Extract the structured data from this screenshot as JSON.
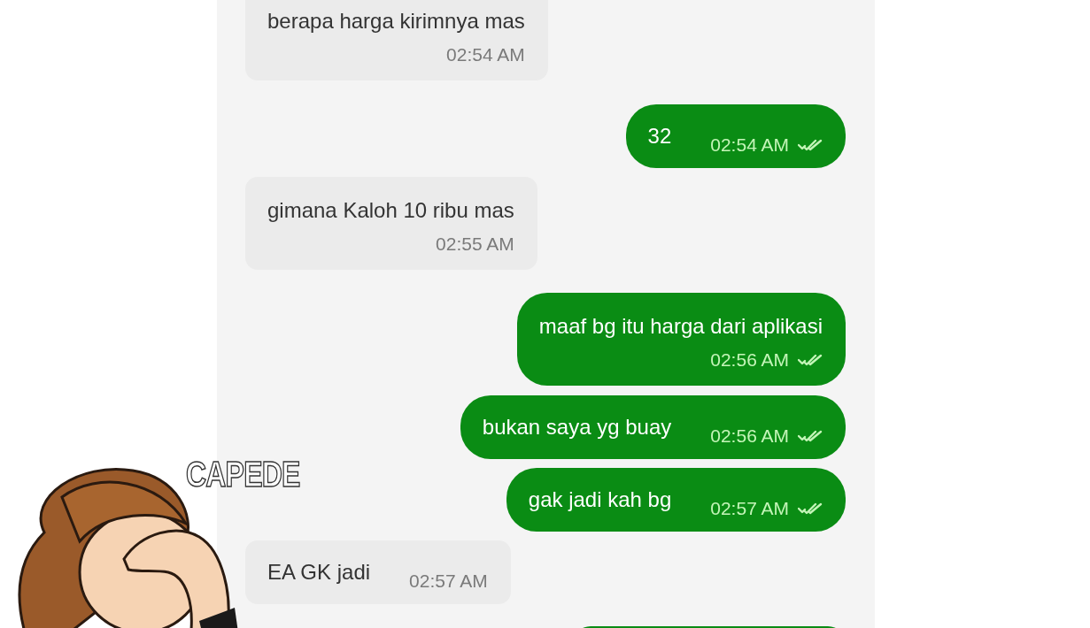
{
  "messages": [
    {
      "outgoing": false,
      "time_below": true,
      "text": "berapa harga kirimnya mas",
      "time": "02:54 AM"
    },
    {
      "outgoing": true,
      "time_below": false,
      "text": "32",
      "time": "02:54 AM",
      "read": true
    },
    {
      "outgoing": false,
      "time_below": true,
      "text": "gimana Kaloh 10 ribu mas",
      "time": "02:55 AM"
    },
    {
      "outgoing": true,
      "time_below": true,
      "text": "maaf bg itu harga dari aplikasi",
      "time": "02:56 AM",
      "read": true
    },
    {
      "outgoing": true,
      "time_below": false,
      "text": "bukan saya yg buay",
      "time": "02:56 AM",
      "read": true
    },
    {
      "outgoing": true,
      "time_below": false,
      "text": "gak jadi kah bg",
      "time": "02:57 AM",
      "read": true
    },
    {
      "outgoing": false,
      "time_below": false,
      "text": "EA GK jadi",
      "time": "02:57 AM"
    },
    {
      "outgoing": true
    }
  ],
  "sticker": {
    "caption": "CAPEDE"
  }
}
